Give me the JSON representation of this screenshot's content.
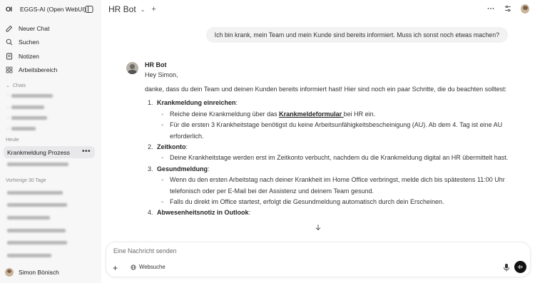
{
  "app": {
    "logo": "OI",
    "name": "EGGS-AI (Open WebUI)"
  },
  "nav": [
    {
      "label": "Neuer Chat",
      "icon": "edit-icon"
    },
    {
      "label": "Suchen",
      "icon": "search-icon"
    },
    {
      "label": "Notizen",
      "icon": "notes-icon"
    },
    {
      "label": "Arbeitsbereich",
      "icon": "workspace-icon"
    }
  ],
  "sections": {
    "chats": "Chats",
    "today": "Heute",
    "last30": "Vorherige 30 Tage"
  },
  "active_chat": "Krankmeldung Prozess",
  "user": {
    "name": "Simon Bönisch"
  },
  "header": {
    "title": "HR Bot"
  },
  "user_message": "Ich bin krank, mein Team und mein Kunde sind bereits informiert. Muss ich sonst noch etwas machen?",
  "bot": {
    "name": "HR Bot",
    "greeting": "Hey Simon,",
    "intro": "danke, dass du dein Team und deinen Kunden bereits informiert hast! Hier sind noch ein paar Schritte, die du beachten solltest:",
    "items": [
      {
        "num": "1.",
        "title": "Krankmeldung einreichen",
        "bullets_pre": "Reiche deine Krankmeldung über das ",
        "link": "Krankmeldeformular ",
        "bullets_post": "bei HR ein.",
        "bullet2": "Für die ersten 3 Krankheitstage benötigst du keine Arbeitsunfähigkeitsbescheinigung (AU). Ab dem 4. Tag ist eine AU erforderlich."
      },
      {
        "num": "2.",
        "title": "Zeitkonto",
        "bullet1": "Deine Krankheitstage werden erst im Zeitkonto verbucht, nachdem du die Krankmeldung digital an HR übermittelt hast."
      },
      {
        "num": "3.",
        "title": "Gesundmeldung",
        "bullet1": "Wenn du den ersten Arbeitstag nach deiner Krankheit im Home Office verbringst, melde dich bis spätestens 11:00 Uhr telefonisch oder per E-Mail bei der Assistenz und deinem Team gesund.",
        "bullet2": "Falls du direkt im Office startest, erfolgt die Gesundmeldung automatisch durch dein Erscheinen."
      },
      {
        "num": "4.",
        "title": "Abwesenheitsnotiz in Outlook"
      }
    ]
  },
  "input": {
    "placeholder": "Eine Nachricht senden",
    "websearch": "Websuche"
  }
}
